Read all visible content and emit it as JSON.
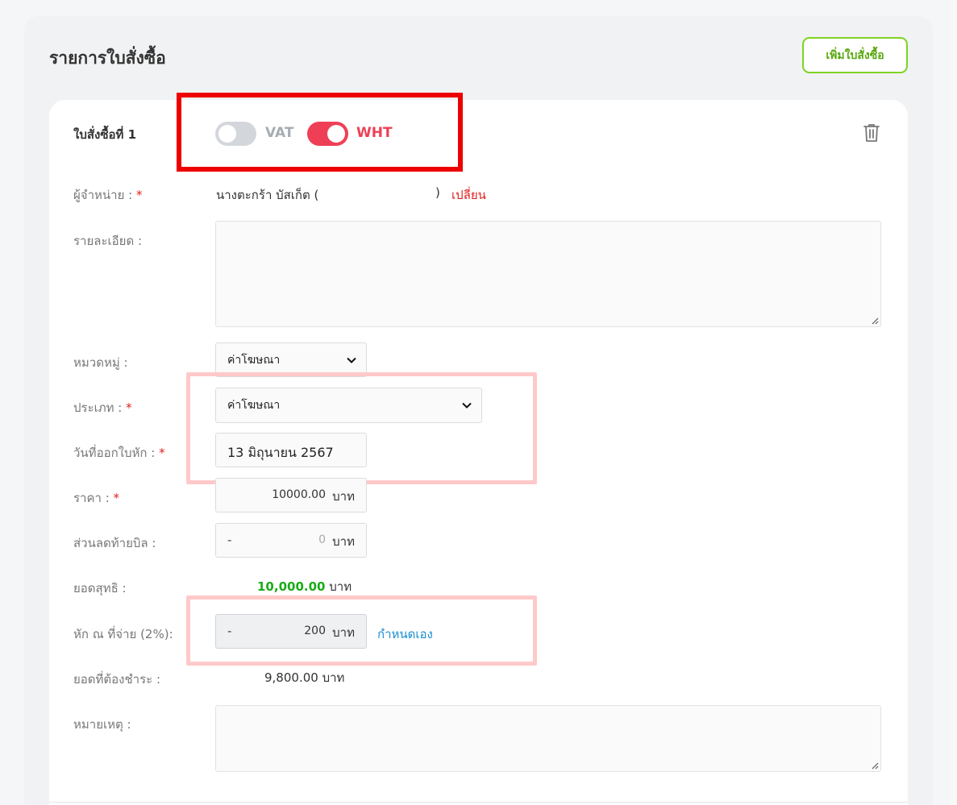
{
  "section": {
    "title": "รายการใบสั่งซื้อ",
    "add_button": "เพิ่มใบสั่งซื้อ"
  },
  "order": {
    "title": "ใบสั่งซื้อที่ 1",
    "vat": {
      "label": "VAT",
      "enabled": false
    },
    "wht": {
      "label": "WHT",
      "enabled": true
    },
    "delete_icon": "trash-icon"
  },
  "fields": {
    "vendor": {
      "label": "ผู้จำหน่าย : ",
      "required": "*",
      "value_prefix": "นางตะกร้า บัสเก็ต (",
      "value_suffix": ")",
      "change_link": "เปลี่ยน"
    },
    "details": {
      "label": "รายละเอียด :",
      "value": ""
    },
    "category": {
      "label": "หมวดหมู่ :",
      "value": "ค่าโฆษณา"
    },
    "type": {
      "label": "ประเภท : ",
      "required": "*",
      "value": "ค่าโฆษณา"
    },
    "wht_date": {
      "label": "วันที่ออกใบหัก : ",
      "required": "*",
      "value": "13 มิถุนายน 2567"
    },
    "price": {
      "label": "ราคา : ",
      "required": "*",
      "value": "10000.00",
      "unit": "บาท"
    },
    "discount": {
      "label": "ส่วนลดท้ายบิล :",
      "sign": "-",
      "value": "0",
      "unit": "บาท"
    },
    "net": {
      "label": "ยอดสุทธิ :",
      "value": "10,000.00",
      "unit": "บาท"
    },
    "withholding": {
      "label": "หัก ณ ที่จ่าย (2%):",
      "sign": "-",
      "value": "200",
      "unit": "บาท",
      "custom_link": "กำหนดเอง"
    },
    "payable": {
      "label": "ยอดที่ต้องชำระ :",
      "value": "9,800.00 บาท"
    },
    "note": {
      "label": "หมายเหตุ :",
      "value": ""
    }
  },
  "colors": {
    "accent_green": "#7ed321",
    "toggle_on": "#ef3f56",
    "required": "#e02020",
    "link_blue": "#1a8fcf",
    "highlight_red": "#ee0000",
    "highlight_pink": "#ffc9c9"
  }
}
